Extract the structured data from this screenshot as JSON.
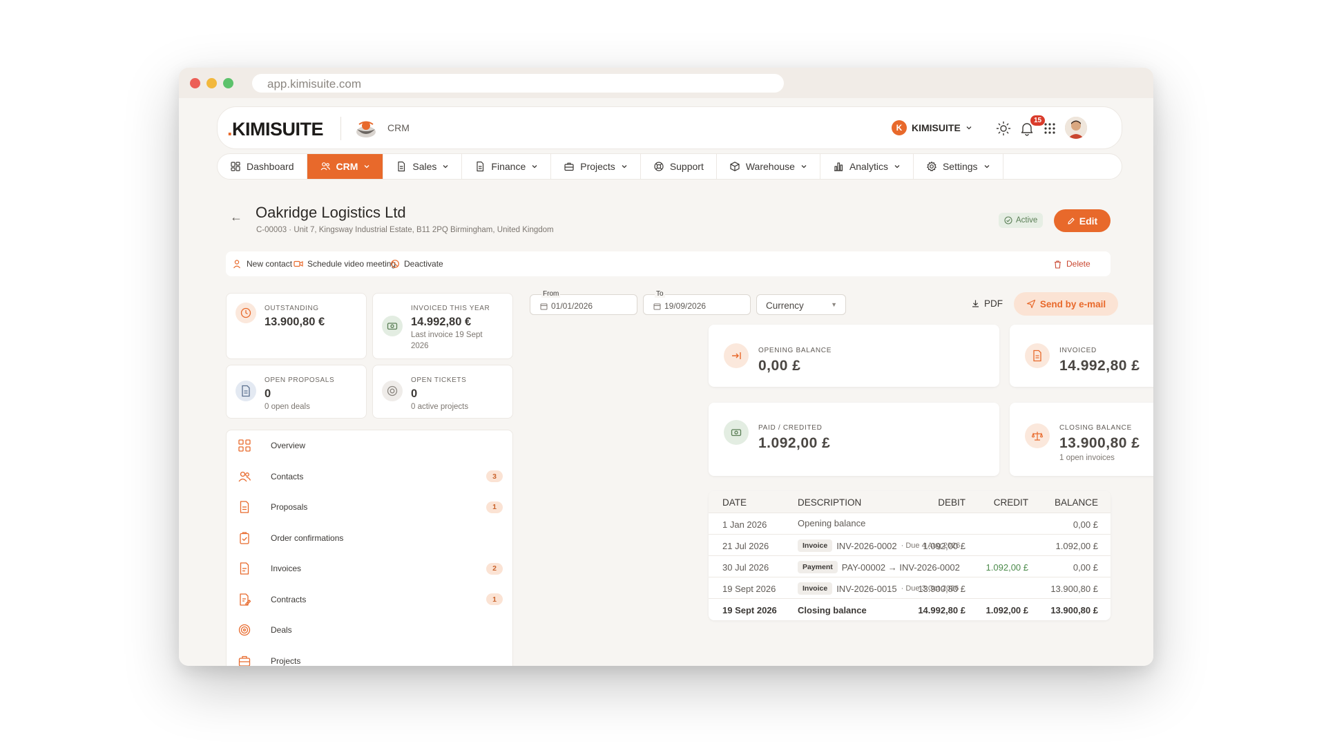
{
  "browser": {
    "url": "app.kimisuite.com"
  },
  "topbar": {
    "logo": "KIMISUITE",
    "logo_dot": ".",
    "module": "CRM",
    "org_initial": "K",
    "org_name": "KIMISUITE",
    "notifications": "15"
  },
  "nav": [
    {
      "label": "Dashboard",
      "icon": "dashboard-icon",
      "active": false,
      "chevron": false
    },
    {
      "label": "CRM",
      "icon": "users-icon",
      "active": true,
      "chevron": true
    },
    {
      "label": "Sales",
      "icon": "document-icon",
      "active": false,
      "chevron": true
    },
    {
      "label": "Finance",
      "icon": "document-icon",
      "active": false,
      "chevron": true
    },
    {
      "label": "Projects",
      "icon": "briefcase-icon",
      "active": false,
      "chevron": true
    },
    {
      "label": "Support",
      "icon": "lifebuoy-icon",
      "active": false,
      "chevron": false
    },
    {
      "label": "Warehouse",
      "icon": "box-icon",
      "active": false,
      "chevron": true
    },
    {
      "label": "Analytics",
      "icon": "bar-chart-icon",
      "active": false,
      "chevron": true
    },
    {
      "label": "Settings",
      "icon": "gear-icon",
      "active": false,
      "chevron": true
    }
  ],
  "header": {
    "title": "Oakridge Logistics Ltd",
    "subtitle": "C-00003 · Unit 7, Kingsway Industrial Estate, B11 2PQ Birmingham, United Kingdom",
    "status": "Active",
    "edit": "Edit"
  },
  "actions": {
    "new_contact": "New contact",
    "schedule": "Schedule video meeting",
    "deactivate": "Deactivate",
    "delete": "Delete"
  },
  "stats": {
    "outstanding": {
      "label": "OUTSTANDING",
      "value": "13.900,80 €"
    },
    "invoiced": {
      "label": "INVOICED THIS YEAR",
      "value": "14.992,80 €",
      "sub": "Last invoice 19 Sept 2026"
    },
    "proposals": {
      "label": "OPEN PROPOSALS",
      "value": "0",
      "sub": "0 open deals"
    },
    "tickets": {
      "label": "OPEN TICKETS",
      "value": "0",
      "sub": "0 active projects"
    }
  },
  "menu": [
    {
      "label": "Overview",
      "badge": ""
    },
    {
      "label": "Contacts",
      "badge": "3"
    },
    {
      "label": "Proposals",
      "badge": "1"
    },
    {
      "label": "Order confirmations",
      "badge": ""
    },
    {
      "label": "Invoices",
      "badge": "2"
    },
    {
      "label": "Contracts",
      "badge": "1"
    },
    {
      "label": "Deals",
      "badge": ""
    },
    {
      "label": "Projects",
      "badge": ""
    }
  ],
  "filters": {
    "from_label": "From",
    "from_value": "01/01/2026",
    "to_label": "To",
    "to_value": "19/09/2026",
    "currency": "Currency",
    "pdf": "PDF",
    "send": "Send by e-mail"
  },
  "balances": {
    "opening": {
      "label": "OPENING BALANCE",
      "value": "0,00 £"
    },
    "invoiced": {
      "label": "INVOICED",
      "value": "14.992,80 £"
    },
    "paid": {
      "label": "PAID / CREDITED",
      "value": "1.092,00 £"
    },
    "closing": {
      "label": "CLOSING BALANCE",
      "value": "13.900,80 £",
      "sub": "1 open invoices"
    }
  },
  "ledger": {
    "headers": {
      "date": "DATE",
      "description": "DESCRIPTION",
      "debit": "DEBIT",
      "credit": "CREDIT",
      "balance": "BALANCE"
    },
    "rows": [
      {
        "date": "1 Jan 2026",
        "tag": "",
        "desc": "Opening balance",
        "due": "",
        "debit": "",
        "credit": "",
        "balance": "0,00 £"
      },
      {
        "date": "21 Jul 2026",
        "tag": "Invoice",
        "desc": "INV-2026-0002",
        "due": "· Due 4 Aug 2026",
        "debit": "1.092,00 £",
        "credit": "",
        "balance": "1.092,00 £"
      },
      {
        "date": "30 Jul 2026",
        "tag": "Payment",
        "desc": "PAY-00002 → INV-2026-0002",
        "due": "",
        "debit": "",
        "credit": "1.092,00 £",
        "balance": "0,00 £"
      },
      {
        "date": "19 Sept 2026",
        "tag": "Invoice",
        "desc": "INV-2026-0015",
        "due": "· Due 3 Oct 2026",
        "debit": "13.900,80 £",
        "credit": "",
        "balance": "13.900,80 £"
      }
    ],
    "total": {
      "date": "19 Sept 2026",
      "desc": "Closing balance",
      "debit": "14.992,80 £",
      "credit": "1.092,00 £",
      "balance": "13.900,80 £"
    }
  },
  "colors": {
    "accent": "#e8692b",
    "success": "#5a7e55",
    "danger": "#c9462f"
  }
}
